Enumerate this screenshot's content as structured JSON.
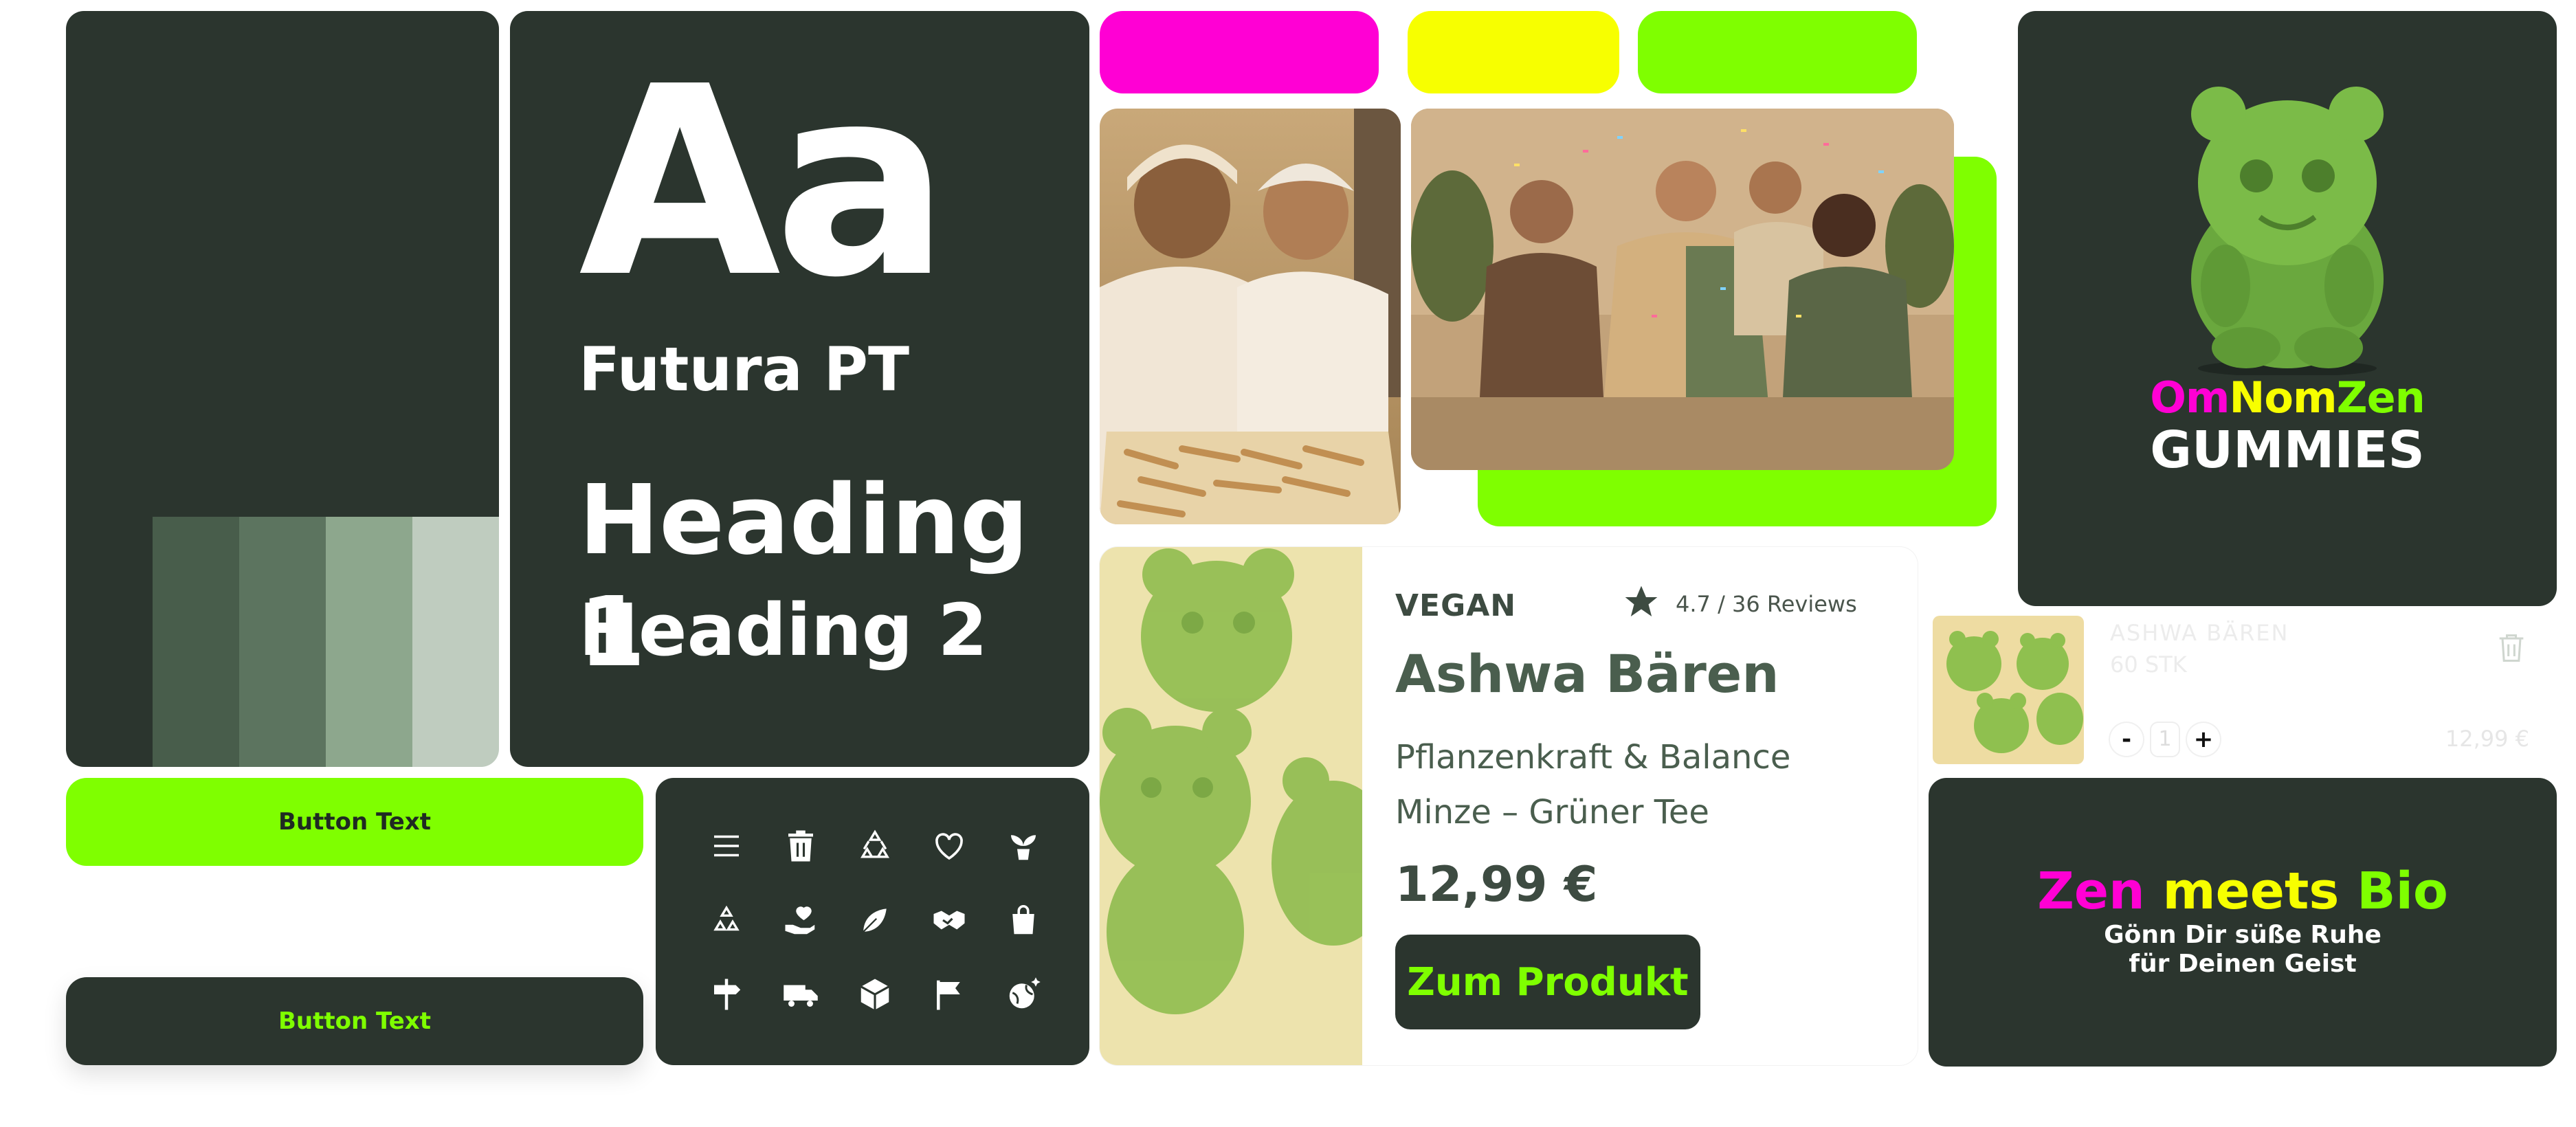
{
  "colors": {
    "dark": "#2b352e",
    "magenta": "#ff00d4",
    "yellow": "#f7ff00",
    "lime": "#7fff00",
    "palette": [
      "#2b352e",
      "#485d4b",
      "#5c745f",
      "#8da78d",
      "#bfccbf"
    ]
  },
  "typography": {
    "sample": "Aa",
    "font_name": "Futura PT",
    "heading1": "Heading 1",
    "heading2": "Heading 2"
  },
  "buttons": {
    "primary_label": "Button Text",
    "secondary_label": "Button Text"
  },
  "icons": [
    "menu-icon",
    "trash-icon",
    "recycle-icon",
    "heart-icon",
    "sprout-icon",
    "recycle-alt-icon",
    "hand-heart-icon",
    "leaf-icon",
    "handshake-icon",
    "shopping-bag-icon",
    "signpost-icon",
    "truck-icon",
    "box-icon",
    "flag-icon",
    "globe-sparkle-icon"
  ],
  "product": {
    "tag": "VEGAN",
    "rating": "4.7 / 36 Reviews",
    "name": "Ashwa Bären",
    "desc_line1": "Pflanzenkraft & Balance",
    "desc_line2": "Minze – Grüner Tee",
    "price": "12,99 €",
    "cta": "Zum Produkt"
  },
  "logo": {
    "brand_om": "Om",
    "brand_nom": "Nom",
    "brand_zen": "Zen",
    "product_line": "GUMMIES"
  },
  "cart": {
    "item_name": "ASHWA BÄREN",
    "item_qty_label": "60 STK",
    "minus": "-",
    "count": "1",
    "plus": "+",
    "price": "12,99 €"
  },
  "zen": {
    "word1": "Zen",
    "word2": "meets",
    "word3": "Bio",
    "line1": "Gönn Dir süße Ruhe",
    "line2": "für Deinen Geist"
  }
}
